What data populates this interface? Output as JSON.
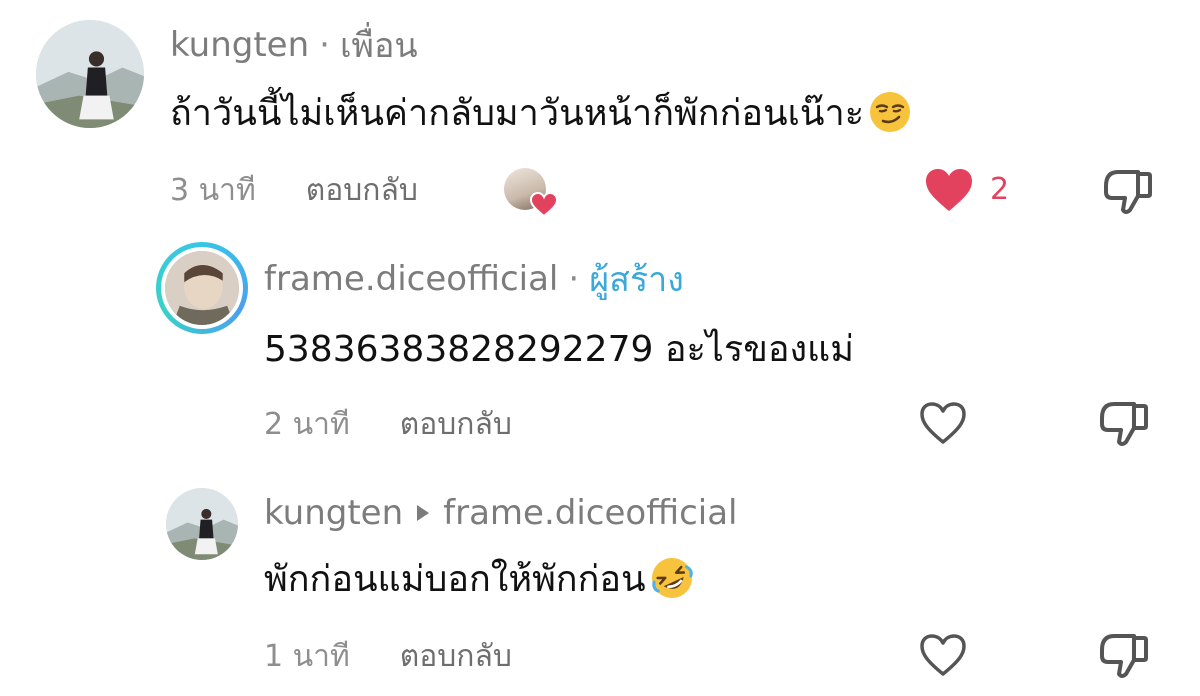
{
  "comments": [
    {
      "username": "kungten",
      "separator": "·",
      "badge": "เพื่อน",
      "text": "ถ้าวันนี้ไม่เห็นค่ากลับมาวันหน้าก็พักก่อนเน๊าะ",
      "emoji": "smirk-emoji",
      "time": "3 นาที",
      "reply_label": "ตอบกลับ",
      "liked_by_creator": true,
      "liked": true,
      "like_count": "2"
    },
    {
      "username": "frame.diceofficial",
      "separator": "·",
      "badge": "ผู้สร้าง",
      "text": "53836383828292279 อะไรของแม่",
      "time": "2 นาที",
      "reply_label": "ตอบกลับ",
      "liked": false
    },
    {
      "username": "kungten",
      "reply_to": "frame.diceofficial",
      "text": "พักก่อนแม่บอกให้พักก่อน",
      "emoji": "rolling-laughing-emoji",
      "time": "1 นาที",
      "reply_label": "ตอบกลับ",
      "liked": false
    }
  ],
  "colors": {
    "heart_liked": "#e3425e",
    "creator_badge": "#3aa8d8",
    "username": "#7c7c7c",
    "meta": "#8e8e8e"
  },
  "icons": [
    "heart-icon",
    "dislike-icon",
    "play-arrow-icon"
  ]
}
